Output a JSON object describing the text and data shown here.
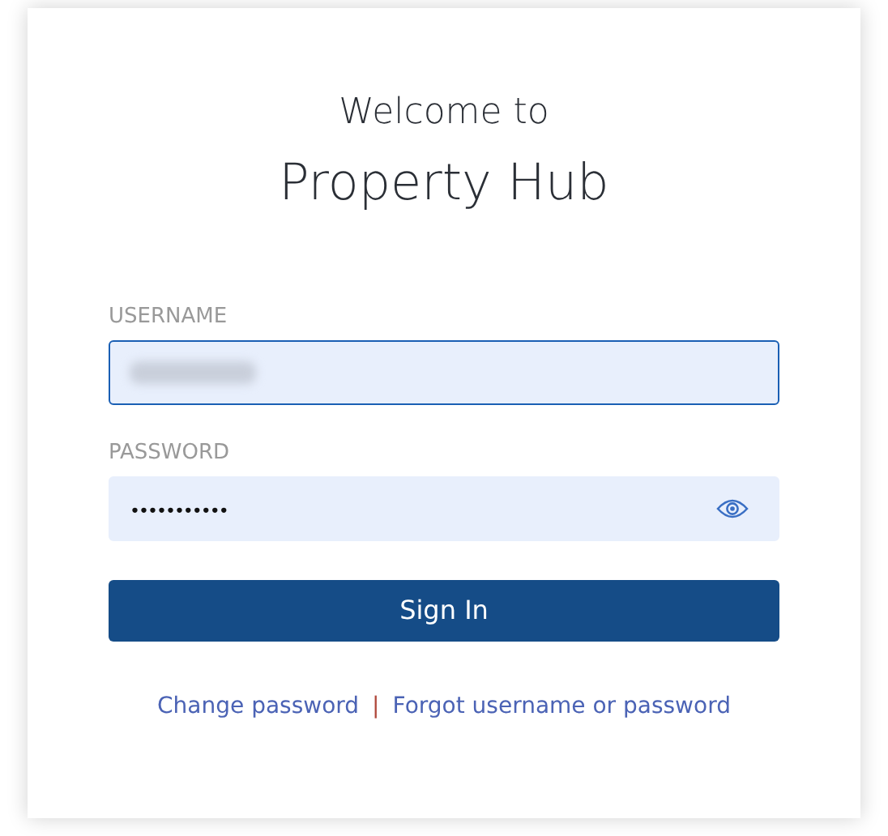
{
  "heading": {
    "welcome": "Welcome to",
    "title": "Property Hub"
  },
  "fields": [
    {
      "label": "USERNAME",
      "focused": true,
      "redacted": true
    },
    {
      "label": "PASSWORD",
      "focused": false,
      "value": "•••••••••••",
      "reveal_toggle": true
    }
  ],
  "submit": "Sign In",
  "links": [
    {
      "label": "Change password"
    },
    {
      "label": "Forgot username or password"
    }
  ],
  "separator": "|"
}
